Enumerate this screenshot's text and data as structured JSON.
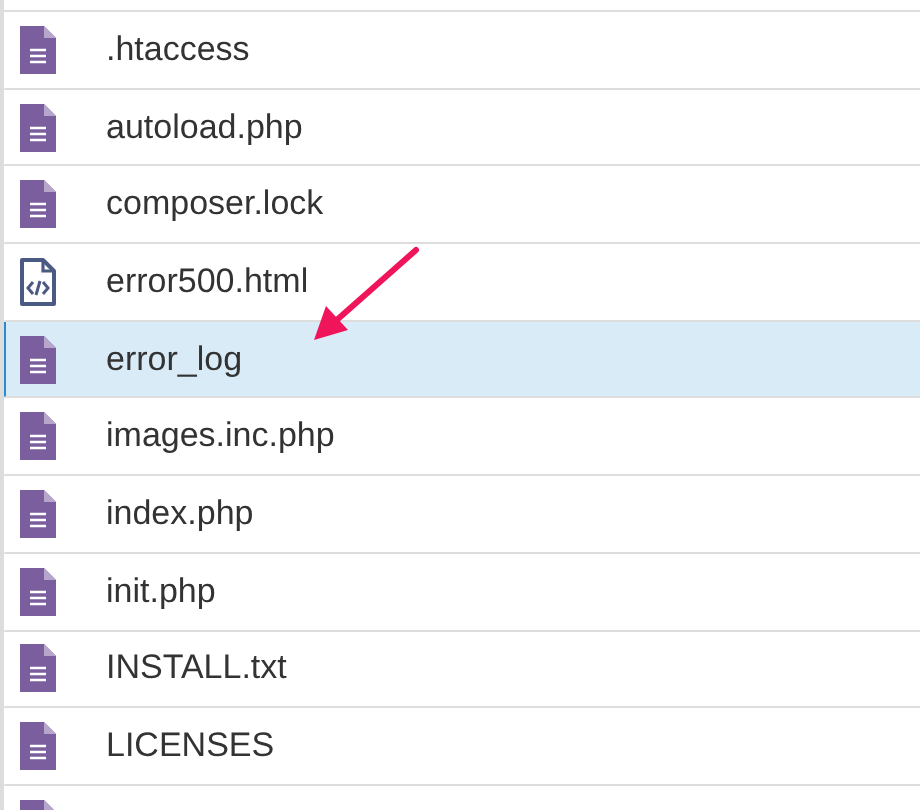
{
  "files": [
    {
      "name": ".htaccess",
      "kind": "text",
      "selected": false
    },
    {
      "name": "autoload.php",
      "kind": "text",
      "selected": false
    },
    {
      "name": "composer.lock",
      "kind": "text",
      "selected": false
    },
    {
      "name": "error500.html",
      "kind": "code",
      "selected": false
    },
    {
      "name": "error_log",
      "kind": "text",
      "selected": true
    },
    {
      "name": "images.inc.php",
      "kind": "text",
      "selected": false
    },
    {
      "name": "index.php",
      "kind": "text",
      "selected": false
    },
    {
      "name": "init.php",
      "kind": "text",
      "selected": false
    },
    {
      "name": "INSTALL.txt",
      "kind": "text",
      "selected": false
    },
    {
      "name": "LICENSES",
      "kind": "text",
      "selected": false
    },
    {
      "kind": "text",
      "selected": false
    }
  ]
}
